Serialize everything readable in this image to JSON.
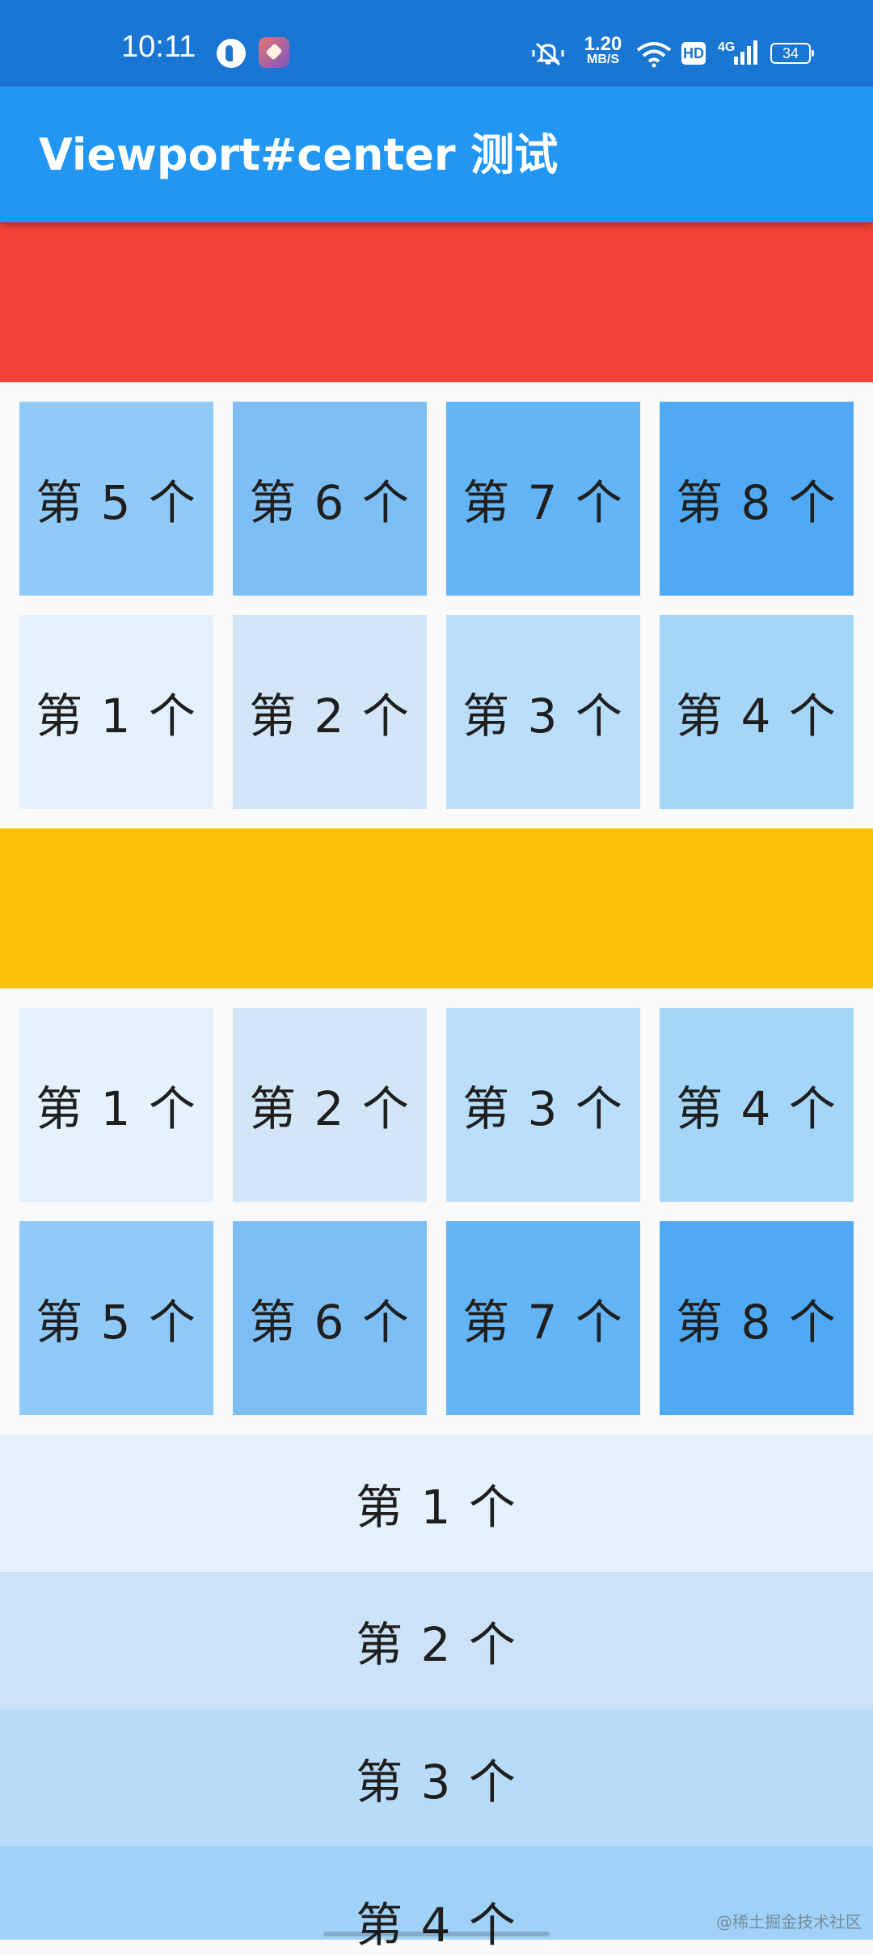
{
  "status_bar": {
    "time": "10:11",
    "speed_value": "1.20",
    "speed_unit": "MB/S",
    "hd": "HD",
    "network": "4G",
    "battery": "34",
    "icons": [
      "app-icon",
      "app-icon",
      "mute-vibrate-icon",
      "wifi-icon",
      "signal-icon",
      "battery-icon"
    ]
  },
  "app_bar": {
    "title": "Viewport#center 测试"
  },
  "colors": {
    "status_bar": "#1976d2",
    "app_bar": "#2196f3",
    "top_band": "#f44336",
    "middle_band": "#ffc107",
    "blue_shades": [
      "#e3f2fd",
      "#d2e6f7",
      "#bbdefb",
      "#a5d5f7",
      "#90caf9",
      "#7dbff5",
      "#64b5f6",
      "#4faaf3"
    ]
  },
  "upper_grid": {
    "row1": [
      "第 5 个",
      "第 6 个",
      "第 7 个",
      "第 8 个"
    ],
    "row2": [
      "第 1 个",
      "第 2 个",
      "第 3 个",
      "第 4 个"
    ]
  },
  "lower_grid": {
    "row1": [
      "第 1 个",
      "第 2 个",
      "第 3 个",
      "第 4 个"
    ],
    "row2": [
      "第 5 个",
      "第 6 个",
      "第 7 个",
      "第 8 个"
    ]
  },
  "list": [
    "第 1 个",
    "第 2 个",
    "第 3 个",
    "第 4 个"
  ],
  "watermark": "@稀土掘金技术社区"
}
